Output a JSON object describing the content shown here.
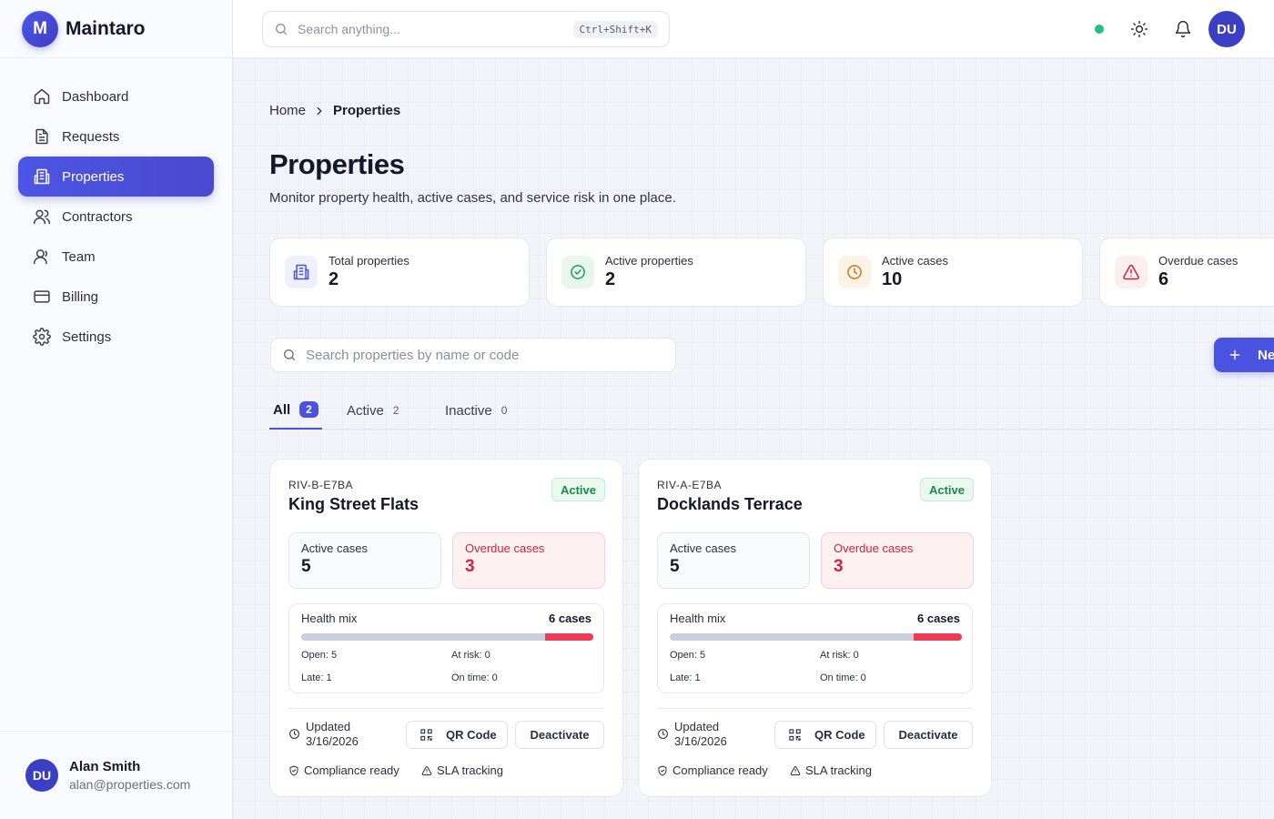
{
  "brand": {
    "initial": "M",
    "name": "Maintaro"
  },
  "sidebar": {
    "items": [
      {
        "label": "Dashboard",
        "icon": "home-icon"
      },
      {
        "label": "Requests",
        "icon": "document-icon"
      },
      {
        "label": "Properties",
        "icon": "building-icon",
        "active": true
      },
      {
        "label": "Contractors",
        "icon": "users-icon"
      },
      {
        "label": "Team",
        "icon": "user-icon"
      },
      {
        "label": "Billing",
        "icon": "credit-card-icon"
      },
      {
        "label": "Settings",
        "icon": "gear-icon"
      }
    ]
  },
  "user": {
    "initials": "DU",
    "name": "Alan Smith",
    "email": "alan@properties.com"
  },
  "topbar": {
    "search_placeholder": "Search anything...",
    "shortcut": "Ctrl+Shift+K",
    "status_color": "#22c07a",
    "avatar_initials": "DU"
  },
  "breadcrumb": {
    "home": "Home",
    "current": "Properties"
  },
  "page": {
    "title": "Properties",
    "subtitle": "Monitor property health, active cases, and service risk in one place."
  },
  "stats": [
    {
      "label": "Total properties",
      "value": "2",
      "icon": "building-icon",
      "color": "#4a52e0",
      "bg": "#eef0fd"
    },
    {
      "label": "Active properties",
      "value": "2",
      "icon": "check-circle-icon",
      "color": "#1f9a57",
      "bg": "#e8f7ee"
    },
    {
      "label": "Active cases",
      "value": "10",
      "icon": "clock-icon",
      "color": "#c9791a",
      "bg": "#fdf3e4"
    },
    {
      "label": "Overdue cases",
      "value": "6",
      "icon": "alert-triangle-icon",
      "color": "#d0233e",
      "bg": "#fdeef0"
    }
  ],
  "property_search": {
    "placeholder": "Search properties by name or code"
  },
  "new_button": {
    "label": "Ne"
  },
  "tabs": [
    {
      "label": "All",
      "count": "2",
      "active": true
    },
    {
      "label": "Active",
      "count": "2"
    },
    {
      "label": "Inactive",
      "count": "0"
    }
  ],
  "colors": {
    "accent": "#4a52e0",
    "open_bar": "#c9d0dc",
    "overdue_bar": "#ec3c55"
  },
  "properties": [
    {
      "code": "RIV-B-E7BA",
      "name": "King Street Flats",
      "status": "Active",
      "active_label": "Active cases",
      "active_cases": "5",
      "overdue_label": "Overdue cases",
      "overdue_cases": "3",
      "health_title": "Health mix",
      "health_total": "6 cases",
      "health_total_count": 6,
      "health_open_count": 5,
      "health_late_count": 1,
      "open": "Open: 5",
      "at_risk": "At risk: 0",
      "late": "Late: 1",
      "on_time": "On time: 0",
      "updated_label": "Updated",
      "updated_date": "3/16/2026",
      "qr_label": "QR Code",
      "deactivate_label": "Deactivate",
      "compliance": "Compliance ready",
      "sla": "SLA tracking"
    },
    {
      "code": "RIV-A-E7BA",
      "name": "Docklands Terrace",
      "status": "Active",
      "active_label": "Active cases",
      "active_cases": "5",
      "overdue_label": "Overdue cases",
      "overdue_cases": "3",
      "health_title": "Health mix",
      "health_total": "6 cases",
      "health_total_count": 6,
      "health_open_count": 5,
      "health_late_count": 1,
      "open": "Open: 5",
      "at_risk": "At risk: 0",
      "late": "Late: 1",
      "on_time": "On time: 0",
      "updated_label": "Updated",
      "updated_date": "3/16/2026",
      "qr_label": "QR Code",
      "deactivate_label": "Deactivate",
      "compliance": "Compliance ready",
      "sla": "SLA tracking"
    }
  ]
}
